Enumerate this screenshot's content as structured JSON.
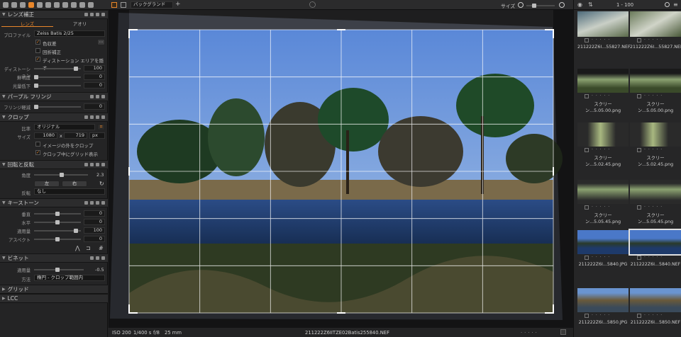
{
  "left_panel": {
    "lens": {
      "title": "レンズ補正",
      "tabs": [
        "レンズ",
        "アオリ"
      ],
      "profile_label": "プロファイル",
      "profile_value": "Zeiss Batis 2/25",
      "chk1": "色収差",
      "chk2": "回折補正",
      "chk3": "ディストーション エリアを隠す",
      "distortion_label": "ディストーション",
      "distortion_value": "100",
      "sharpness_label": "鮮明度",
      "sharpness_value": "0",
      "falloff_label": "光量低下",
      "falloff_value": "0"
    },
    "purple": {
      "title": "パープル フリンジ",
      "label": "フリンジ軽減",
      "value": "0"
    },
    "crop": {
      "title": "クロップ",
      "ratio_label": "比率",
      "ratio_value": "オリジナル",
      "size_label": "サイズ",
      "w": "1080",
      "x": "x",
      "h": "719",
      "unit": "px",
      "chk1": "イメージの外をクロップ",
      "chk2": "クロップ中にグリッド表示"
    },
    "rotate": {
      "title": "回転と反転",
      "angle_label": "角度",
      "angle_value": "2.3",
      "left": "左",
      "right": "右",
      "flip_label": "反転",
      "flip_value": "なし"
    },
    "keystone": {
      "title": "キーストーン",
      "v_label": "垂直",
      "v_value": "0",
      "h_label": "水平",
      "h_value": "0",
      "amount_label": "適用量",
      "amount_value": "100",
      "aspect_label": "アスペクト",
      "aspect_value": "0"
    },
    "vignette": {
      "title": "ビネット",
      "amount_label": "適用量",
      "amount_value": "-0.5",
      "method_label": "方法",
      "method_value": "楕円 - クロップ範囲内"
    },
    "grid_title": "グリッド",
    "lcc_title": "LCC"
  },
  "toolbar": {
    "layer": "バックグランド",
    "size_label": "サイズ",
    "counter": "1 - 100"
  },
  "status": {
    "iso": "ISO 200",
    "shutter": "1/400 s",
    "aperture": "f/8",
    "focal": "25 mm",
    "filename": "211222Z6IITZE02Batis255840.NEF"
  },
  "thumbs": [
    "211222Z6I...55827.NEF",
    "211222Z6I...55827.NEF",
    "スクリーン...5.05.00.png",
    "スクリーン...5.05.00.png",
    "スクリーン...5.02.45.png",
    "スクリーン...5.02.45.png",
    "スクリーン...5.05.45.png",
    "スクリーン...5.05.45.png",
    "211222Z6I...5840.JPG",
    "211222Z6I...5840.NEF",
    "211222Z6I...5850.JPG",
    "211222Z6I...5850.NEF"
  ],
  "accent": "#e8862a"
}
